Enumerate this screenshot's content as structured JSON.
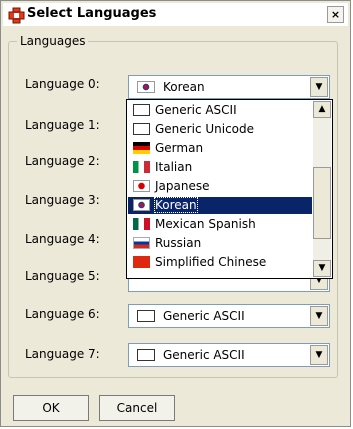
{
  "window": {
    "title": "Select Languages",
    "close_glyph": "×"
  },
  "group": {
    "title": "Languages"
  },
  "rows": [
    {
      "label": "Language 0:",
      "value": "Korean",
      "flag": "flag-kr"
    },
    {
      "label": "Language 1:"
    },
    {
      "label": "Language 2:"
    },
    {
      "label": "Language 3:"
    },
    {
      "label": "Language 4:"
    },
    {
      "label": "Language 5:"
    },
    {
      "label": "Language 6:",
      "value": "Generic ASCII",
      "flag": "flag-ascii"
    },
    {
      "label": "Language 7:",
      "value": "Generic ASCII",
      "flag": "flag-ascii"
    }
  ],
  "dropdown": {
    "items": [
      {
        "text": "Generic ASCII",
        "flag": "flag-ascii"
      },
      {
        "text": "Generic Unicode",
        "flag": "flag-ascii"
      },
      {
        "text": "German",
        "flag": "flag-de"
      },
      {
        "text": "Italian",
        "flag": "flag-it"
      },
      {
        "text": "Japanese",
        "flag": "flag-jp"
      },
      {
        "text": "Korean",
        "flag": "flag-kr",
        "selected": true
      },
      {
        "text": "Mexican Spanish",
        "flag": "flag-mx"
      },
      {
        "text": "Russian",
        "flag": "flag-ru"
      },
      {
        "text": "Simplified Chinese",
        "flag": "flag-cn"
      }
    ],
    "scroll_up_glyph": "▲",
    "scroll_down_glyph": "▼"
  },
  "combo_arrow_glyph": "▼",
  "buttons": {
    "ok": "OK",
    "cancel": "Cancel"
  }
}
